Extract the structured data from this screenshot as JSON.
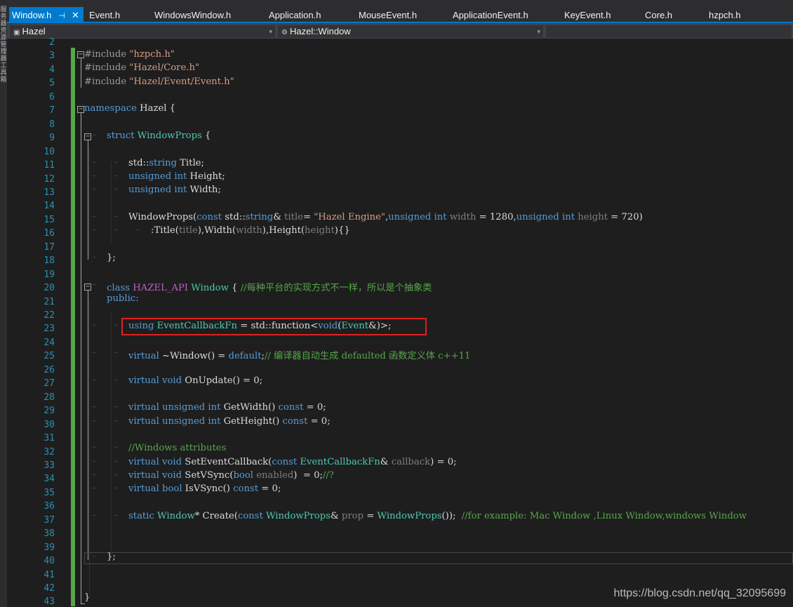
{
  "sidebar": {
    "vertical_label": "服务器资源管理器工具箱"
  },
  "tabs": [
    {
      "label": "Window.h",
      "active": true,
      "pin": "⊣",
      "close": "✕"
    },
    {
      "label": "Event.h"
    },
    {
      "label": "WindowsWindow.h"
    },
    {
      "label": "Application.h"
    },
    {
      "label": "MouseEvent.h"
    },
    {
      "label": "ApplicationEvent.h"
    },
    {
      "label": "KeyEvent.h"
    },
    {
      "label": "Core.h"
    },
    {
      "label": "hzpch.h"
    }
  ],
  "nav": {
    "project": "Hazel",
    "scope": "Hazel::Window",
    "dropdown_caret": "▾"
  },
  "line_numbers": [
    "2",
    "3",
    "4",
    "5",
    "6",
    "7",
    "8",
    "9",
    "10",
    "11",
    "12",
    "13",
    "14",
    "15",
    "16",
    "17",
    "18",
    "19",
    "20",
    "21",
    "22",
    "23",
    "24",
    "25",
    "26",
    "27",
    "28",
    "29",
    "30",
    "31",
    "32",
    "33",
    "34",
    "35",
    "36",
    "37",
    "38",
    "39",
    "40",
    "41",
    "42",
    "43"
  ],
  "code": {
    "l3_a": "#include ",
    "l3_b": "\"hzpch.h\"",
    "l4_a": "#include ",
    "l4_b": "\"Hazel/Core.h\"",
    "l5_a": "#include ",
    "l5_b": "\"Hazel/Event/Event.h\"",
    "l7_a": "namespace",
    "l7_b": " Hazel {",
    "l9_a": "struct",
    "l9_b": "WindowProps",
    "l9_c": " {",
    "l11_a": "std::",
    "l11_b": "string",
    "l11_c": " Title;",
    "l12_a": "unsigned int",
    "l12_b": " Height;",
    "l13_a": "unsigned int",
    "l13_b": " Width;",
    "l15_a": "WindowProps(",
    "l15_b": "const",
    "l15_c": " std::",
    "l15_d": "string",
    "l15_e": "& ",
    "l15_f": "title",
    "l15_g": "= ",
    "l15_h": "\"Hazel Engine\"",
    "l15_i": ",",
    "l15_j": "unsigned int",
    "l15_k": " ",
    "l15_l": "width",
    "l15_m": " = 1280,",
    "l15_n": "unsigned int",
    "l15_o": " ",
    "l15_p": "height",
    "l15_q": " = 720)",
    "l16_a": ":Title(",
    "l16_b": "title",
    "l16_c": "),Width(",
    "l16_d": "width",
    "l16_e": "),Height(",
    "l16_f": "height",
    "l16_g": "){}",
    "l18": "};",
    "l20_a": "class",
    "l20_b": "HAZEL_API",
    "l20_c": "Window",
    "l20_d": " { ",
    "l20_e": "//每种平台的实现方式不一样，所以是个抽象类",
    "l21": "public:",
    "l23_a": "using",
    "l23_b": "EventCallbackFn",
    "l23_c": " = std::",
    "l23_d": "function",
    "l23_e": "<",
    "l23_f": "void",
    "l23_g": "(",
    "l23_h": "Event",
    "l23_i": "&)>;",
    "l25_a": "virtual",
    "l25_b": " ~Window() = ",
    "l25_c": "default",
    "l25_d": ";",
    "l25_e": "// 编译器自动生成 defaulted 函数定义体 c++11",
    "l27_a": "virtual void",
    "l27_b": " OnUpdate() = 0;",
    "l29_a": "virtual unsigned int",
    "l29_b": " GetWidth() ",
    "l29_c": "const",
    "l29_d": " = 0;",
    "l30_a": "virtual unsigned int",
    "l30_b": " GetHeight() ",
    "l30_c": "const",
    "l30_d": " = 0;",
    "l32": "//Windows attributes",
    "l33_a": "virtual void",
    "l33_b": " SetEventCallback(",
    "l33_c": "const",
    "l33_d": " ",
    "l33_e": "EventCallbackFn",
    "l33_f": "& ",
    "l33_g": "callback",
    "l33_h": ") = 0;",
    "l34_a": "virtual void",
    "l34_b": " SetVSync(",
    "l34_c": "bool",
    "l34_d": " ",
    "l34_e": "enabled",
    "l34_f": ")  = 0;",
    "l34_g": "//?",
    "l35_a": "virtual bool",
    "l35_b": " IsVSync() ",
    "l35_c": "const",
    "l35_d": " = 0;",
    "l37_a": "static",
    "l37_b": " ",
    "l37_c": "Window",
    "l37_d": "* Create(",
    "l37_e": "const",
    "l37_f": " ",
    "l37_g": "WindowProps",
    "l37_h": "& ",
    "l37_i": "prop",
    "l37_j": " = ",
    "l37_k": "WindowProps",
    "l37_l": "());  ",
    "l37_m": "//for example: Mac Window ,Linux Window,windows Window",
    "l40": "};",
    "l43": "}"
  },
  "fold_symbol": "−",
  "tab_marker": "→",
  "watermark": "https://blog.csdn.net/qq_32095699",
  "colors": {
    "background": "#1e1e1e",
    "accent": "#007acc",
    "line_number": "#2b91af",
    "keyword": "#569cd6",
    "type": "#4ec9b0",
    "string": "#d69d85",
    "comment": "#57a64a",
    "highlight_box": "#e02020"
  }
}
